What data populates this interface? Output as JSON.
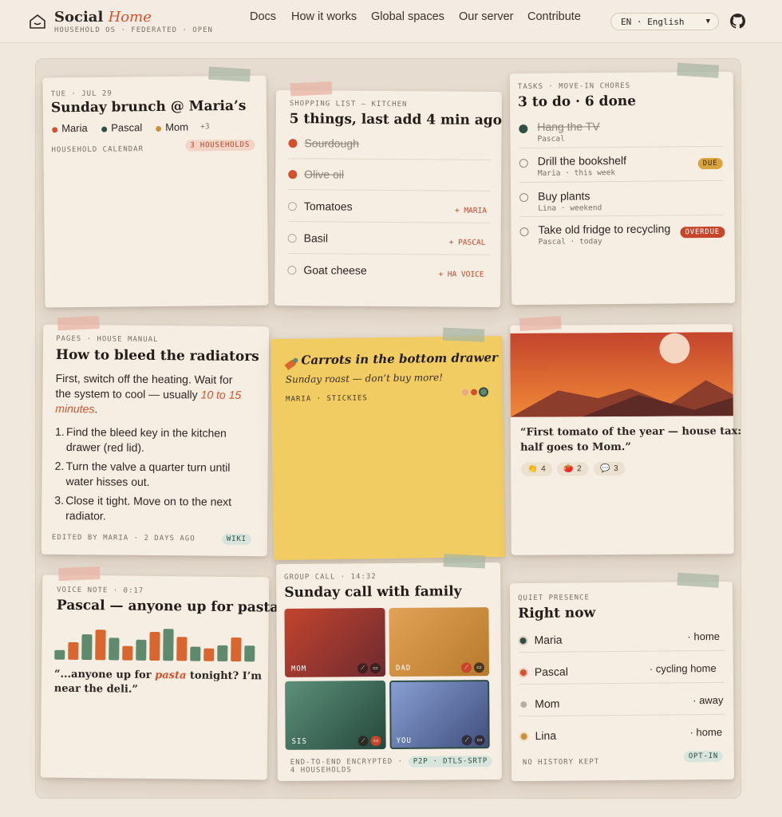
{
  "header": {
    "brand_part1": "Social",
    "brand_part2": "Home",
    "tagline": "HOUSEHOLD OS · FEDERATED · OPEN",
    "nav": [
      "Docs",
      "How it works",
      "Global spaces",
      "Our server",
      "Contribute"
    ],
    "language": "EN · English",
    "github_icon": "github-icon"
  },
  "calendar": {
    "eyebrow": "TUE · JUL 29",
    "title": "Sunday brunch @ Maria’s",
    "people": [
      {
        "name": "Maria",
        "color": "#d2522e"
      },
      {
        "name": "Pascal",
        "color": "#2f4f43"
      },
      {
        "name": "Mom",
        "color": "#c9923a"
      }
    ],
    "more": "+3",
    "footer": "HOUSEHOLD CALENDAR",
    "badge": "3 HOUSEHOLDS"
  },
  "shopping": {
    "eyebrow": "SHOPPING LIST — KITCHEN",
    "title": "5 things, last add 4 min ago",
    "items": [
      {
        "label": "Sourdough",
        "done": true,
        "by": ""
      },
      {
        "label": "Olive oil",
        "done": true,
        "by": ""
      },
      {
        "label": "Tomatoes",
        "done": false,
        "by": "+ MARIA"
      },
      {
        "label": "Basil",
        "done": false,
        "by": "+ PASCAL"
      },
      {
        "label": "Goat cheese",
        "done": false,
        "by": "+ HA VOICE"
      }
    ]
  },
  "tasks": {
    "eyebrow": "TASKS · MOVE-IN CHORES",
    "title": "3 to do · 6 done",
    "items": [
      {
        "label": "Hang the TV",
        "meta": "Pascal",
        "done": true,
        "badge": ""
      },
      {
        "label": "Drill the bookshelf",
        "meta": "Maria · this week",
        "done": false,
        "badge": "DUE"
      },
      {
        "label": "Buy plants",
        "meta": "Lina · weekend",
        "done": false,
        "badge": ""
      },
      {
        "label": "Take old fridge to recycling",
        "meta": "Pascal · today",
        "done": false,
        "badge": "OVERDUE"
      }
    ]
  },
  "pages": {
    "eyebrow": "PAGES · HOUSE MANUAL",
    "title": "How to bleed the radiators",
    "intro_1": "First, switch off the heating. Wait for",
    "intro_2": "the system to cool — usually",
    "intro_highlight_a": "10 to 15",
    "intro_highlight_b": "minutes",
    "steps": [
      [
        "Find the bleed key in the kitchen",
        "drawer (red lid)."
      ],
      [
        "Turn the valve a quarter turn until",
        "water hisses out."
      ],
      [
        "Close it tight. Move on to the next",
        "radiator."
      ]
    ],
    "footer": "EDITED BY MARIA · 2 DAYS AGO",
    "badge": "WIKI"
  },
  "sticky": {
    "title": "Carrots in the bottom drawer",
    "subtitle": "Sunday roast — don’t buy more!",
    "meta": "MARIA · STICKIES",
    "swatches": [
      "#e6a98c",
      "#d2522e",
      "#5f8a6e"
    ]
  },
  "photo": {
    "caption_1": "“First tomato of the year — house tax:",
    "caption_2": "half goes to Mom.”",
    "reactions": [
      {
        "icon": "clap-icon",
        "glyph": "👏",
        "count": "4"
      },
      {
        "icon": "tomato-icon",
        "glyph": "🍅",
        "count": "2"
      },
      {
        "icon": "comment-icon",
        "glyph": "💬",
        "count": "3"
      }
    ]
  },
  "voice": {
    "eyebrow": "VOICE NOTE · 0:17",
    "title": "Pascal — anyone up for pasta?",
    "waveform": [
      0.3,
      0.55,
      0.8,
      0.95,
      0.7,
      0.45,
      0.65,
      0.9,
      1.0,
      0.75,
      0.45,
      0.4,
      0.5,
      0.75,
      0.5
    ],
    "quote_a": "“...anyone up for",
    "quote_highlight": "pasta",
    "quote_b": "tonight? I’m",
    "quote_c": "near the deli.”"
  },
  "call": {
    "eyebrow": "GROUP CALL · 14:32",
    "title": "Sunday call with family",
    "tiles": [
      {
        "label": "MOM",
        "from": "#c2442e",
        "to": "#6e2a30"
      },
      {
        "label": "DAD",
        "from": "#e2a257",
        "to": "#b77a2c"
      },
      {
        "label": "SIS",
        "from": "#5c9079",
        "to": "#25483c"
      },
      {
        "label": "YOU",
        "from": "#8aa0d4",
        "to": "#3e4d7c"
      }
    ],
    "footer_1": "END-TO-END ENCRYPTED ·",
    "footer_2": "4 HOUSEHOLDS",
    "badge": "P2P · DTLS-SRTP"
  },
  "presence": {
    "eyebrow": "QUIET PRESENCE",
    "title": "Right now",
    "people": [
      {
        "name": "Maria",
        "status": "· home",
        "color": "#2f4f43"
      },
      {
        "name": "Pascal",
        "status": "· cycling home",
        "color": "#d2522e"
      },
      {
        "name": "Mom",
        "status": "· away",
        "color": "#b9ada0"
      },
      {
        "name": "Lina",
        "status": "· home",
        "color": "#c9923a"
      }
    ],
    "footer": "NO HISTORY KEPT",
    "badge": "OPT-IN"
  }
}
